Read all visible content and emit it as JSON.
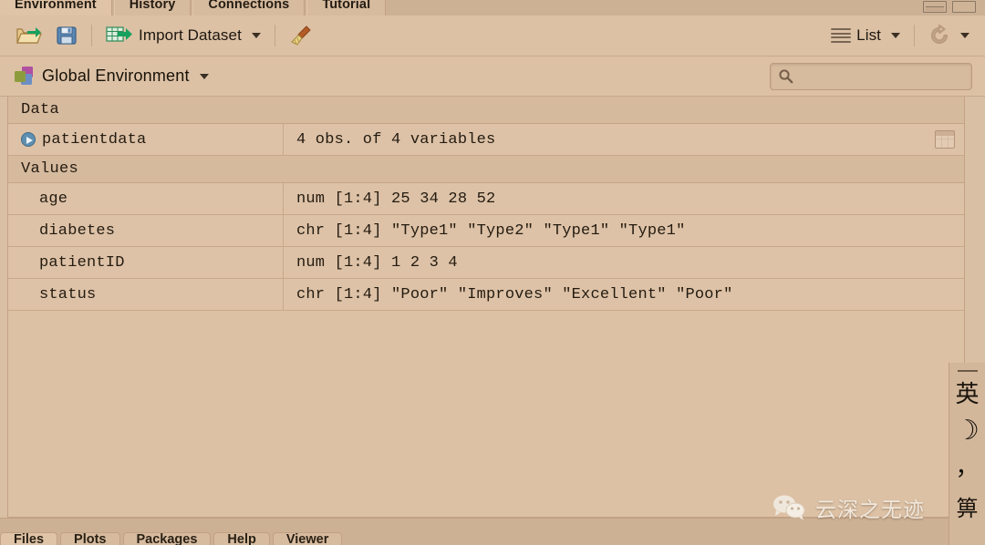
{
  "window": {
    "tabs": [
      {
        "label": "Environment",
        "active": true
      },
      {
        "label": "History",
        "active": false
      },
      {
        "label": "Connections",
        "active": false
      },
      {
        "label": "Tutorial",
        "active": false
      }
    ],
    "controls": {
      "minimize_title": "Minimize",
      "maximize_title": "Maximize"
    }
  },
  "toolbar": {
    "open_workspace_icon": "open-folder-icon",
    "save_workspace_icon": "save-disk-icon",
    "import_dataset_label": "Import Dataset",
    "import_dataset_icon": "import-table-icon",
    "clear_objects_icon": "broom-icon",
    "view_mode_label": "List",
    "view_mode_icon": "list-lines-icon",
    "refresh_icon": "refresh-icon"
  },
  "environment": {
    "selector_label": "Global Environment",
    "selector_icon": "environment-cubes-icon",
    "search_placeholder": "",
    "search_value": "",
    "search_icon": "search-icon"
  },
  "objects": {
    "groups": [
      {
        "label": "Data",
        "rows": [
          {
            "name": "patientdata",
            "value": "4 obs. of 4 variables",
            "expandable": true,
            "has_grid_view": true
          }
        ]
      },
      {
        "label": "Values",
        "rows": [
          {
            "name": "age",
            "value": "num [1:4] 25 34 28 52",
            "expandable": false,
            "has_grid_view": false
          },
          {
            "name": "diabetes",
            "value": "chr [1:4] \"Type1\" \"Type2\" \"Type1\" \"Type1\"",
            "expandable": false,
            "has_grid_view": false
          },
          {
            "name": "patientID",
            "value": "num [1:4] 1 2 3 4",
            "expandable": false,
            "has_grid_view": false
          },
          {
            "name": "status",
            "value": "chr [1:4] \"Poor\" \"Improves\" \"Excellent\" \"Poor\"",
            "expandable": false,
            "has_grid_view": false
          }
        ]
      }
    ]
  },
  "bottom_tabs": [
    {
      "label": "Files",
      "active": true
    },
    {
      "label": "Plots",
      "active": false
    },
    {
      "label": "Packages",
      "active": false
    },
    {
      "label": "Help",
      "active": false
    },
    {
      "label": "Viewer",
      "active": false
    }
  ],
  "ime_panel": {
    "grip_icon": "drag-grip-icon",
    "language_label": "英",
    "moon_label": "☽",
    "punctuation_label": "，",
    "extra_label": "箅"
  },
  "watermark": {
    "logo_icon": "wechat-icon",
    "text": "云深之无迹"
  },
  "colors": {
    "background": "#dcc1a5",
    "tabstrip": "#cdb195",
    "border": "#c3a285",
    "text": "#241b10",
    "expander": "#5e8fb0"
  }
}
